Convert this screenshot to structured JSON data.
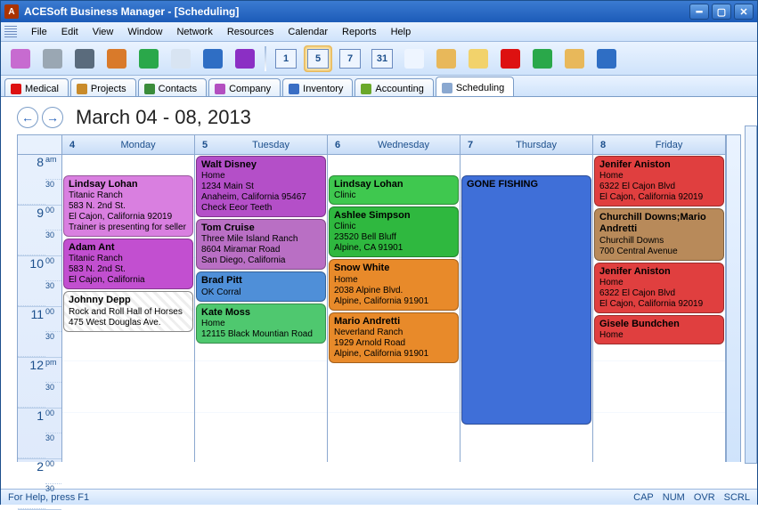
{
  "window": {
    "title": "ACESoft Business Manager - [Scheduling]",
    "app_initial": "A"
  },
  "menu": [
    "File",
    "Edit",
    "View",
    "Window",
    "Network",
    "Resources",
    "Calendar",
    "Reports",
    "Help"
  ],
  "toolbar": {
    "group1": [
      {
        "name": "new-doc-icon",
        "color": "#c76bd0"
      },
      {
        "name": "print-preview-icon",
        "color": "#9aa7b3"
      },
      {
        "name": "print-icon",
        "color": "#5a6b7c"
      },
      {
        "name": "palette-icon",
        "color": "#d97a2a"
      },
      {
        "name": "parrot-icon",
        "color": "#2aa84a"
      },
      {
        "name": "folder-icon",
        "color": "#d8e4f2"
      },
      {
        "name": "help-icon",
        "color": "#2f6ec4"
      },
      {
        "name": "book-icon",
        "color": "#8b2fc4"
      }
    ],
    "group2": [
      {
        "name": "view-1day-icon",
        "label": "1",
        "color": "#eef5ff"
      },
      {
        "name": "view-5day-icon",
        "label": "5",
        "color": "#eef5ff",
        "selected": true
      },
      {
        "name": "view-7day-icon",
        "label": "7",
        "color": "#eef5ff"
      },
      {
        "name": "view-31day-icon",
        "label": "31",
        "color": "#eef5ff"
      },
      {
        "name": "calendar-grid-icon",
        "color": "#eef5ff"
      },
      {
        "name": "home-icon",
        "color": "#e8b85a"
      },
      {
        "name": "note-icon",
        "color": "#f2d26b"
      },
      {
        "name": "tag-icon",
        "color": "#d11"
      },
      {
        "name": "clock-icon",
        "color": "#2aa84a"
      },
      {
        "name": "bell-icon",
        "color": "#e8b85a"
      },
      {
        "name": "alarm-icon",
        "color": "#2f6ec4"
      }
    ]
  },
  "tabs": [
    {
      "id": "medical",
      "label": "Medical",
      "icon": "#d11"
    },
    {
      "id": "projects",
      "label": "Projects",
      "icon": "#c98b2a"
    },
    {
      "id": "contacts",
      "label": "Contacts",
      "icon": "#3a8c3a"
    },
    {
      "id": "company",
      "label": "Company",
      "icon": "#b34fc0"
    },
    {
      "id": "inventory",
      "label": "Inventory",
      "icon": "#3a6ec4"
    },
    {
      "id": "accounting",
      "label": "Accounting",
      "icon": "#6aa82a"
    },
    {
      "id": "scheduling",
      "label": "Scheduling",
      "icon": "#8aa8d0",
      "active": true
    }
  ],
  "calendar": {
    "date_range": "March 04 - 08, 2013",
    "time_slots": [
      {
        "hour": "8",
        "suffix": "am"
      },
      {
        "hour": "9",
        "suffix": "00"
      },
      {
        "hour": "10",
        "suffix": "00"
      },
      {
        "hour": "11",
        "suffix": "00"
      },
      {
        "hour": "12",
        "suffix": "pm"
      },
      {
        "hour": "1",
        "suffix": "00"
      },
      {
        "hour": "2",
        "suffix": "00"
      }
    ],
    "half_label": "30",
    "days": [
      {
        "num": "4",
        "name": "Monday",
        "appts": [
          {
            "title": "Lindsay Lohan",
            "lines": [
              "Titanic Ranch",
              "583 N. 2nd St.",
              "El Cajon, California 92019",
              "Trainer is presenting for seller"
            ],
            "bg": "#d97fe0",
            "topspace": true
          },
          {
            "title": "Adam Ant",
            "lines": [
              "Titanic Ranch",
              "583 N. 2nd St.",
              "El Cajon, California"
            ],
            "bg": "#c24fd0"
          },
          {
            "title": "Johnny Depp",
            "lines": [
              "Rock and Roll Hall of Horses",
              "475 West Douglas Ave."
            ],
            "striped": true
          }
        ]
      },
      {
        "num": "5",
        "name": "Tuesday",
        "appts": [
          {
            "title": "Walt Disney",
            "lines": [
              "Home",
              "1234 Main St",
              "Anaheim, California 95467",
              "Check Eeor Teeth"
            ],
            "bg": "#b44fc8"
          },
          {
            "title": "Tom Cruise",
            "lines": [
              "Three Mile Island Ranch",
              "8604 Miramar Road",
              "San Diego, California"
            ],
            "bg": "#b96fc4"
          },
          {
            "title": "Brad Pitt",
            "lines": [
              "OK Corral"
            ],
            "bg": "#4f8fd8"
          },
          {
            "title": "Kate Moss",
            "lines": [
              "Home",
              "12115 Black Mountian Road"
            ],
            "bg": "#4fc86f"
          }
        ]
      },
      {
        "num": "6",
        "name": "Wednesday",
        "appts": [
          {
            "title": "Lindsay Lohan",
            "lines": [
              "Clinic"
            ],
            "bg": "#3fc84f",
            "topspace": true
          },
          {
            "title": "Ashlee Simpson",
            "lines": [
              "Clinic",
              "23520 Bell Bluff",
              "Alpine, CA  91901"
            ],
            "bg": "#2fb83f"
          },
          {
            "title": "Snow White",
            "lines": [
              "Home",
              "2038 Alpine Blvd.",
              "Alpine, California 91901"
            ],
            "bg": "#e88a2a"
          },
          {
            "title": "Mario Andretti",
            "lines": [
              "Neverland Ranch",
              "1929 Arnold Road",
              "Alpine, California 91901"
            ],
            "bg": "#e88a2a"
          }
        ]
      },
      {
        "num": "7",
        "name": "Thursday",
        "appts": [
          {
            "title": "GONE FISHING",
            "lines": [],
            "bg": "#3f6fd8",
            "tall": true,
            "topspace": true
          }
        ]
      },
      {
        "num": "8",
        "name": "Friday",
        "appts": [
          {
            "title": "Jenifer Aniston",
            "lines": [
              "Home",
              "6322 El Cajon Blvd",
              "El Cajon, California 92019"
            ],
            "bg": "#e03f3f"
          },
          {
            "title": "Churchill Downs;Mario Andretti",
            "lines": [
              "Churchill Downs",
              "700 Central Avenue"
            ],
            "bg": "#b88a5a"
          },
          {
            "title": "Jenifer Aniston",
            "lines": [
              "Home",
              "6322 El Cajon Blvd",
              "El Cajon, California 92019"
            ],
            "bg": "#e03f3f"
          },
          {
            "title": "Gisele Bundchen",
            "lines": [
              "Home"
            ],
            "bg": "#e03f3f"
          }
        ]
      }
    ]
  },
  "status": {
    "help": "For Help, press F1",
    "caps": "CAP",
    "num": "NUM",
    "ovr": "OVR",
    "scrl": "SCRL"
  }
}
